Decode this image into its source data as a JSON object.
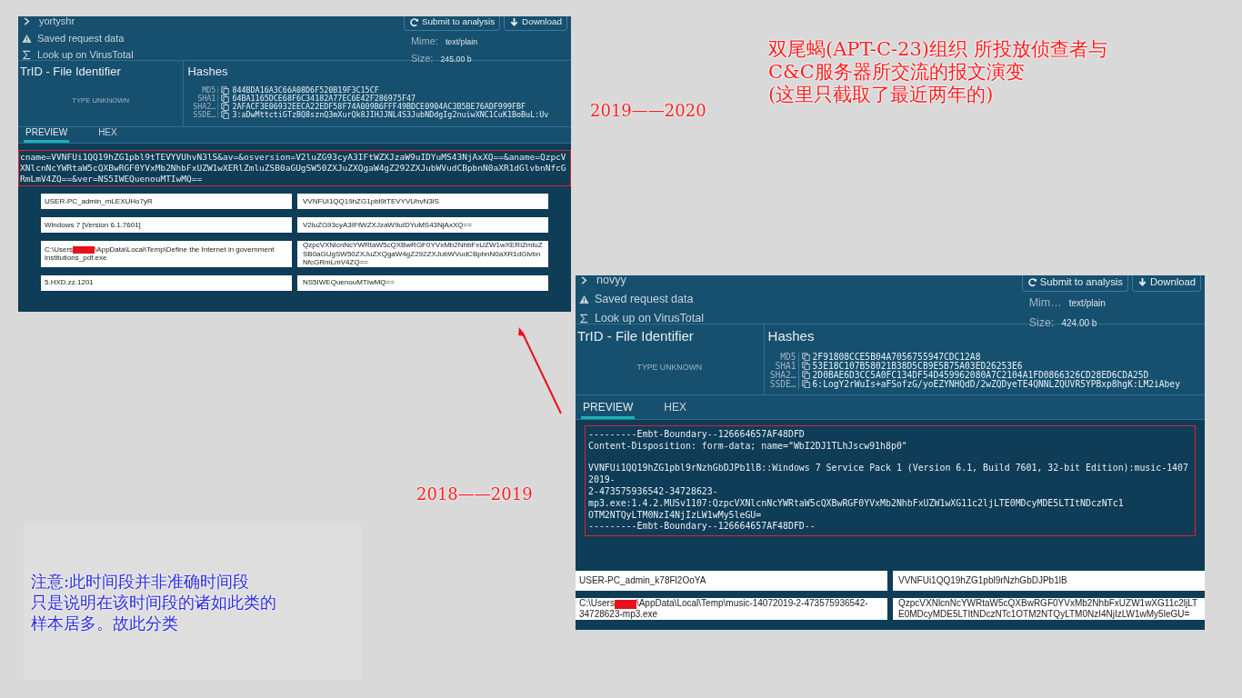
{
  "title_lines": [
    "双尾蝎(APT-C-23)组织 所投放侦查者与",
    "C&C服务器所交流的报文演变",
    "(这里只截取了最近两年的)"
  ],
  "period_labels": [
    "2019——2020",
    "2018——2019"
  ],
  "note_lines": [
    "注意:此时间段并非准确时间段",
    "只是说明在该时间段的诸如此类的",
    "样本居多。故此分类"
  ],
  "panels": [
    {
      "crumb": "yortyshr",
      "links": [
        {
          "kind": "warning",
          "label": "Saved request data"
        },
        {
          "kind": "sigma",
          "label": "Look up on VirusTotal"
        }
      ],
      "buttons": [
        {
          "kind": "refresh",
          "label": "Submit to analysis"
        },
        {
          "kind": "download",
          "label": "Download"
        }
      ],
      "mime_label": "Mime:",
      "mime": "text/plain",
      "size_label": "Size:",
      "size": "245.00 b",
      "trid_title": "TrID - File Identifier",
      "trid_value": "TYPE UNKNOWN",
      "hashes_title": "Hashes",
      "hashes": [
        {
          "label": "MD5",
          "value": "844BDA16A3C66A08D6F520B19F3C15CF"
        },
        {
          "label": "SHA1",
          "value": "64BA1165DCE68F6C34182A77EC6E42F286975F47"
        },
        {
          "label": "SHA2…",
          "value": "2AFACF3E06932EECA22EDF58F74A009B6FFF49BDCE0904AC3B5BE76ADF999FBF"
        },
        {
          "label": "SSDE…",
          "value": "3:aDwMttctiGTzBQ8sznQ3mXurQk8JIHJJNL4S3JubNDdgIg2nuiwXNC1CuK1BoBuL:Uv"
        }
      ],
      "tabs": [
        {
          "label": "PREVIEW",
          "selected": true
        },
        {
          "label": "HEX",
          "selected": false
        }
      ],
      "preview": [
        [
          "cname=VVNFUi1QQ19hZG1pbl9tTEVYVUhvN3lS&av=&osversion=V2luZG93cyA3IFtWZXJzaW9uIDYuMS43NjAxXQ==&aname=QzpcVXNlcnNcYWRtaW5cQXBwRGF0YVxMb2NhbFxUZW1wXERlZmluZSB0aGUgSW50ZXJuZXQgaW4gZ292ZXJubWVudCBpbnN0aXR1dGlvbnNfcGRmLmV4ZQ==&ver=NS5IWEQuenouMTIwMQ=="
        ]
      ],
      "rows": [
        {
          "left": "USER-PC_admin_mLEXUHo7yR",
          "right": "VVNFUi1QQ19hZG1pbl9tTEVYVUhvN3lS"
        },
        {
          "left": "Windows 7 [Version 6.1.7601]",
          "right": "V2luZG93cyA3IFtWZXJzaW9uIDYuMS43NjAxXQ=="
        },
        {
          "left_before": "C:\\Users",
          "left_after": "\\AppData\\Local\\Temp\\Define the Internet in government institutions_pdf.exe",
          "right": "QzpcVXNlcnNcYWRtaW5cQXBwRGF0YVxMb2NhbFxUZW1wXERlZmluZSB0aGUgSW50ZXJuZXQgaW4gZ292ZXJubWVudCBpbnN0aXR1dGlvbnNfcGRmLmV4ZQ=="
        },
        {
          "left": "5.HXD.zz.1201",
          "right": "NS5IWEQuenouMTIwMQ=="
        }
      ]
    },
    {
      "crumb": "novyy",
      "links": [
        {
          "kind": "warning",
          "label": "Saved request data"
        },
        {
          "kind": "sigma",
          "label": "Look up on VirusTotal"
        }
      ],
      "buttons": [
        {
          "kind": "refresh",
          "label": "Submit to analysis"
        },
        {
          "kind": "download",
          "label": "Download"
        }
      ],
      "mime_label": "Mim…",
      "mime": "text/plain",
      "size_label": "Size:",
      "size": "424.00 b",
      "trid_title": "TrID - File Identifier",
      "trid_value": "TYPE UNKNOWN",
      "hashes_title": "Hashes",
      "hashes": [
        {
          "label": "MD5",
          "value": "2F91808CCE5B04A7056755947CDC12A8"
        },
        {
          "label": "SHA1",
          "value": "53E18C107B58021B38D5CB9E5B75A03ED26253E6"
        },
        {
          "label": "SHA2…",
          "value": "2D0BAE6D3CC5A0FC134DF54D459962080A7C2104A1FD0866326CD28ED6CDA25D"
        },
        {
          "label": "SSDE…",
          "value": "6:LogY2rWuIs+aFSofzG/yoEZYNHQdD/2wZQDyeTE4QNNLZQUVR5YPBxp8hgK:LM2iAbey"
        }
      ],
      "tabs": [
        {
          "label": "PREVIEW",
          "selected": true
        },
        {
          "label": "HEX",
          "selected": false
        }
      ],
      "preview": [
        [
          "---------Embt-Boundary--126664657AF48DFD",
          "Content-Disposition: form-data; name=\"WbI2DJ1TLhJscw91h8p0\""
        ],
        [
          "VVNFUi1QQ19hZG1pbl9rNzhGbDJPb1lB::Windows 7 Service Pack 1 (Version 6.1, Build 7601, 32-bit Edition):music-14072019-",
          "2-473575936542-34728623-",
          "mp3.exe:1.4.2.MUSv1107:QzpcVXNlcnNcYWRtaW5cQXBwRGF0YVxMb2NhbFxUZW1wXG11c2ljLTE0MDcyMDE5LTItNDczNTc1",
          "OTM2NTQyLTM0NzI4NjIzLW1wMy5leGU=",
          "---------Embt-Boundary--126664657AF48DFD--"
        ]
      ],
      "rows": [
        {
          "left": "USER-PC_admin_k78Fl2OoYA",
          "right": "VVNFUi1QQ19hZG1pbl9rNzhGbDJPb1lB"
        },
        {
          "left_before": "C:\\Users",
          "left_after": "\\AppData\\Local\\Temp\\music-14072019-2-473575936542-34728623-mp3.exe",
          "right": "QzpcVXNlcnNcYWRtaW5cQXBwRGF0YVxMb2NhbFxUZW1wXG11c2ljLTE0MDcyMDE5LTItNDczNTc1OTM2NTQyLTM0NzI4NjIzLW1wMy5leGU="
        }
      ]
    }
  ]
}
